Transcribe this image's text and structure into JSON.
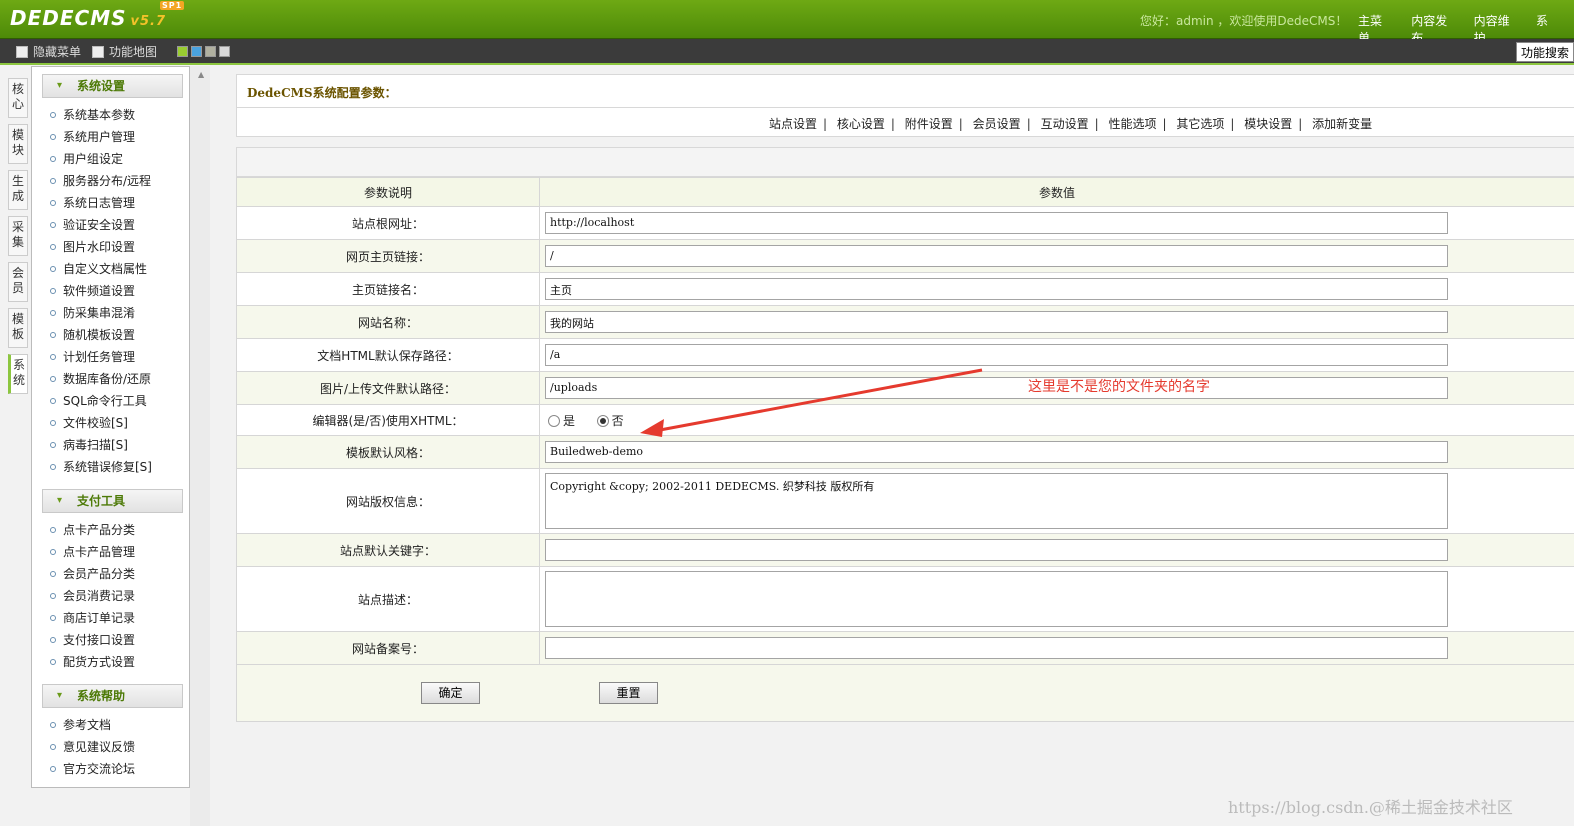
{
  "brand": {
    "logo_text": "DEDECMS",
    "version": "v5.7",
    "badge": "SP1"
  },
  "topbar": {
    "greeting": "您好：admin ，欢迎使用DedeCMS！",
    "nav": [
      "主菜单",
      "内容发布",
      "内容维护",
      "系"
    ]
  },
  "toolbar": {
    "hide_menu": "隐藏菜单",
    "function_map": "功能地图",
    "function_search": "功能搜索",
    "swatch_colors": [
      "#9acd32",
      "#4aa3df",
      "#b0b0a0",
      "#d8d8d8"
    ]
  },
  "vtabs": [
    "核心",
    "模块",
    "生成",
    "采集",
    "会员",
    "模板",
    "系统"
  ],
  "sidebar": {
    "sections": [
      {
        "title": "系统设置",
        "items": [
          "系统基本参数",
          "系统用户管理",
          "用户组设定",
          "服务器分布/远程",
          "系统日志管理",
          "验证安全设置",
          "图片水印设置",
          "自定义文档属性",
          "软件频道设置",
          "防采集串混淆",
          "随机模板设置",
          "计划任务管理",
          "数据库备份/还原",
          "SQL命令行工具",
          "文件校验[S]",
          "病毒扫描[S]",
          "系统错误修复[S]"
        ]
      },
      {
        "title": "支付工具",
        "items": [
          "点卡产品分类",
          "点卡产品管理",
          "会员产品分类",
          "会员消费记录",
          "商店订单记录",
          "支付接口设置",
          "配货方式设置"
        ]
      },
      {
        "title": "系统帮助",
        "items": [
          "参考文档",
          "意见建议反馈",
          "官方交流论坛"
        ]
      }
    ]
  },
  "main": {
    "title": "DedeCMS系统配置参数：",
    "tabs": [
      "站点设置",
      "核心设置",
      "附件设置",
      "会员设置",
      "互动设置",
      "性能选项",
      "其它选项",
      "模块设置",
      "添加新变量"
    ],
    "table_headers": [
      "参数说明",
      "参数值"
    ],
    "rows": {
      "site_root": {
        "label": "站点根网址：",
        "value": "http://localhost"
      },
      "home_link": {
        "label": "网页主页链接：",
        "value": "/"
      },
      "home_name": {
        "label": "主页链接名：",
        "value": "主页"
      },
      "site_name": {
        "label": "网站名称：",
        "value": "我的网站"
      },
      "html_path": {
        "label": "文档HTML默认保存路径：",
        "value": "/a"
      },
      "upload_path": {
        "label": "图片/上传文件默认路径：",
        "value": "/uploads"
      },
      "editor_xhtml": {
        "label": "编辑器(是/否)使用XHTML：",
        "yes": "是",
        "no": "否",
        "selected": "否"
      },
      "template_style": {
        "label": "模板默认风格：",
        "value": "Builedweb-demo"
      },
      "copyright": {
        "label": "网站版权信息：",
        "value": "Copyright &copy; 2002-2011 DEDECMS. 织梦科技 版权所有"
      },
      "keywords": {
        "label": "站点默认关键字：",
        "value": ""
      },
      "description": {
        "label": "站点描述：",
        "value": ""
      },
      "icp": {
        "label": "网站备案号：",
        "value": ""
      }
    },
    "buttons": {
      "ok": "确定",
      "reset": "重置"
    }
  },
  "annotation": {
    "text": "这里是不是您的文件夹的名字",
    "color": "#e53a2e"
  },
  "watermark": "https://blog.csdn.@稀土掘金技术社区"
}
